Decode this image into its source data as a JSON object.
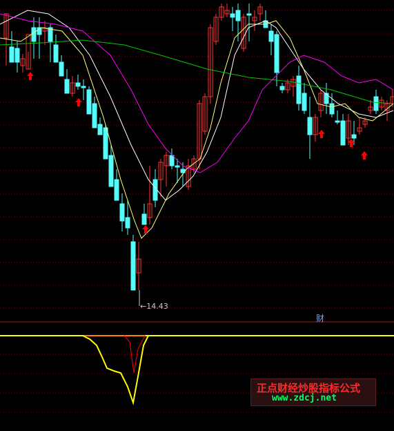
{
  "chart": {
    "low_price_label": "14.43",
    "indicator_tab_label": "财",
    "watermark": {
      "title": "正点财经炒股指标公式",
      "url": "www.zdcj.net"
    },
    "colors": {
      "background": "#000000",
      "up_candle": "#ff3232",
      "down_candle": "#54fcfc",
      "grid": "#8b0000",
      "ma_short": "#ffff80",
      "ma_mid": "#ffffff",
      "ma_long": "#ff00ff",
      "ma_xlong": "#00c800",
      "signal_arrow": "#ff0000",
      "indicator_line": "#ffff00",
      "indicator_fill": "#ff0000"
    },
    "signal_arrow_icon": "up-arrow-icon"
  }
}
